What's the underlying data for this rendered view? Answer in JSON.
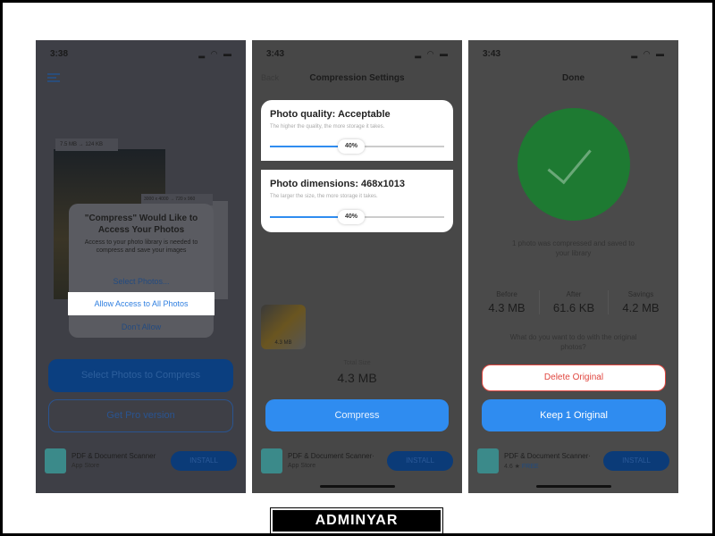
{
  "panel1": {
    "status_time": "3:38",
    "photo_badge_1": "7.5 MB → 124 KB",
    "photo_badge_2": "3000 x 4000 → 720 x 960",
    "dialog": {
      "title": "\"Compress\" Would Like to Access Your Photos",
      "message": "Access to your photo library is needed to compress and save your images",
      "select_photos": "Select Photos...",
      "allow_all": "Allow Access to All Photos",
      "dont_allow": "Don't Allow"
    },
    "select_button": "Select Photos to Compress",
    "pro_button": "Get Pro version",
    "ad": {
      "title": "PDF & Document Scanner",
      "subtitle": "App Store",
      "install": "INSTALL"
    }
  },
  "panel2": {
    "status_time": "3:43",
    "back": "Back",
    "title": "Compression Settings",
    "quality": {
      "title": "Photo quality: Acceptable",
      "hint": "The higher the quality, the more storage it takes.",
      "value_label": "40%",
      "value": 40
    },
    "dimensions": {
      "title": "Photo dimensions: 468x1013",
      "hint": "The larger the size, the more storage it takes.",
      "value_label": "40%",
      "value": 40
    },
    "thumb_size": "4.3 MB",
    "total_label": "Total Size",
    "total_value": "4.3 MB",
    "compress": "Compress",
    "ad": {
      "title": "PDF & Document Scanner·",
      "subtitle": "App Store",
      "install": "INSTALL"
    }
  },
  "panel3": {
    "status_time": "3:43",
    "title": "Done",
    "message": "1 photo was compressed and saved to your library",
    "stats": [
      {
        "label": "Before",
        "value": "4.3 MB"
      },
      {
        "label": "After",
        "value": "61.6 KB"
      },
      {
        "label": "Savings",
        "value": "4.2 MB"
      }
    ],
    "question": "What do you want to do with the original photos?",
    "delete": "Delete Original",
    "keep": "Keep 1 Original",
    "ad": {
      "title": "PDF & Document Scanner·",
      "rating": "4.6 ★",
      "price": "FREE",
      "install": "INSTALL"
    }
  },
  "watermark": "ADMINYAR",
  "colors": {
    "accent": "#2f8cf0",
    "success": "#1e7a32",
    "danger": "#e0463f"
  }
}
